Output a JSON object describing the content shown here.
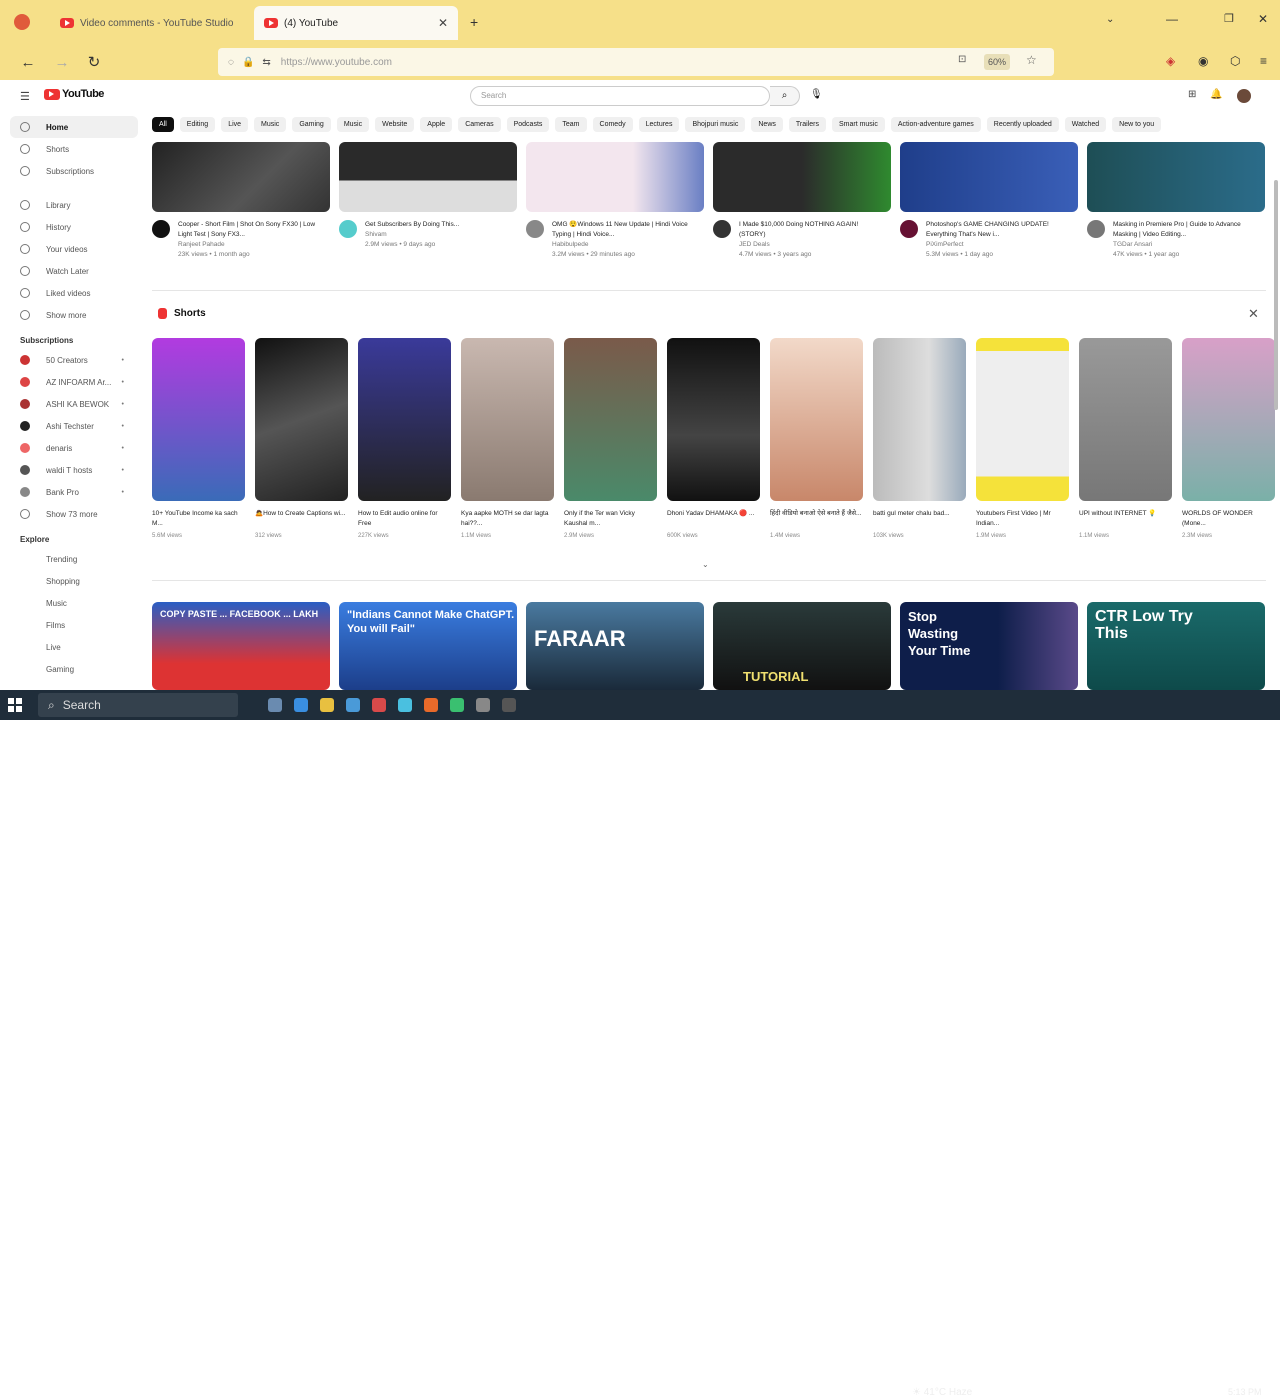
{
  "browser": {
    "tabs": [
      {
        "title": "Video comments - YouTube Studio"
      },
      {
        "title": "(4) YouTube"
      }
    ],
    "url": "https://www.youtube.com",
    "zoom": "60%"
  },
  "header": {
    "logo_text": "YouTube",
    "search_placeholder": "Search"
  },
  "chips": [
    "All",
    "Editing",
    "Live",
    "Music",
    "Gaming",
    "Music",
    "Website",
    "Apple",
    "Cameras",
    "Podcasts",
    "Team",
    "Comedy",
    "Lectures",
    "Bhojpuri music",
    "News",
    "Trailers",
    "Smart music",
    "Action-adventure games",
    "Recently uploaded",
    "Watched",
    "New to you"
  ],
  "sidebar": {
    "items": [
      {
        "label": "Home"
      },
      {
        "label": "Shorts"
      },
      {
        "label": "Subscriptions"
      }
    ],
    "items2": [
      {
        "label": "Library"
      },
      {
        "label": "History"
      },
      {
        "label": "Your videos"
      },
      {
        "label": "Watch Later"
      },
      {
        "label": "Liked videos"
      },
      {
        "label": "Show more"
      }
    ],
    "subs_heading": "Subscriptions",
    "subs": [
      {
        "label": "50 Creators"
      },
      {
        "label": "AZ INFOARM Ar..."
      },
      {
        "label": "ASHI KA BEWOK"
      },
      {
        "label": "Ashi Techster"
      },
      {
        "label": "denaris"
      },
      {
        "label": "waldi T hosts"
      },
      {
        "label": "Bank Pro"
      }
    ],
    "subs_more": "Show 73 more",
    "explore_heading": "Explore",
    "explore": [
      {
        "label": "Trending"
      },
      {
        "label": "Shopping"
      },
      {
        "label": "Music"
      },
      {
        "label": "Films"
      },
      {
        "label": "Live"
      },
      {
        "label": "Gaming"
      }
    ]
  },
  "videos_top": [
    {
      "title": "Cooper - Short Film | Shot On Sony FX30 | Low Light Test | Sony FX3...",
      "channel": "Ranjeet Pahade",
      "stats": "23K views • 1 month ago"
    },
    {
      "title": "Get Subscribers By Doing This...",
      "channel": "Shivam",
      "stats": "2.9M views • 9 days ago"
    },
    {
      "title": "OMG 😲Windows 11 New Update | Hindi Voice Typing | Hindi Voice...",
      "channel": "Habibulpede",
      "stats": "3.2M views • 29 minutes ago"
    },
    {
      "title": "I Made $10,000 Doing NOTHING AGAIN! (STORY)",
      "channel": "JED Deals",
      "stats": "4.7M views • 3 years ago"
    },
    {
      "title": "Photoshop's GAME CHANGING UPDATE! Everything That's New i...",
      "channel": "PiXimPerfect",
      "stats": "5.3M views • 1 day ago"
    },
    {
      "title": "Masking in Premiere Pro | Guide to Advance Masking | Video Editing...",
      "channel": "TGDar Ansari",
      "stats": "47K views • 1 year ago"
    }
  ],
  "shorts": {
    "title": "Shorts",
    "items": [
      {
        "title": "10+ YouTube Income ka sach M...",
        "views": "5.6M views"
      },
      {
        "title": "🙇How to Create Captions wi...",
        "views": "312 views"
      },
      {
        "title": "How to Edit audio online for Free",
        "views": "227K views"
      },
      {
        "title": "Kya aapke MOTH se dar lagta hai??...",
        "views": "1.1M views"
      },
      {
        "title": "Only if the Ter wan Vicky Kaushal m...",
        "views": "2.9M views"
      },
      {
        "title": "Dhoni Yadav DHAMAKA 🔴 ...",
        "views": "600K views"
      },
      {
        "title": "हिंदी वीडियो बनाओ ऐसे बनाते हैं जैसे...",
        "views": "1.4M views"
      },
      {
        "title": "batti gul meter chalu bad...",
        "views": "103K views"
      },
      {
        "title": "Youtubers First Video | Mr Indian...",
        "views": "1.9M views"
      },
      {
        "title": "UPI without INTERNET 💡",
        "views": "1.1M views"
      },
      {
        "title": "WORLDS OF WONDER (Mone...",
        "views": "2.3M views"
      }
    ]
  },
  "videos_bottom": [
    {
      "caption": "COPY PASTE ... FACEBOOK ... LAKH"
    },
    {
      "caption": "\"Indians Cannot Make ChatGPT. You will Fail\""
    },
    {
      "caption": "FARAAR"
    },
    {
      "caption": "TUTORIAL"
    },
    {
      "caption": "Stop Wasting Your Time"
    },
    {
      "caption": "CTR Low Try This"
    }
  ],
  "taskbar": {
    "search": "Search",
    "weather": "41°C Haze",
    "time": "5:13 PM"
  },
  "colors": {
    "browser_chrome": "#f6e089",
    "yt_red": "#e33",
    "taskbar": "#1f2d3a"
  }
}
